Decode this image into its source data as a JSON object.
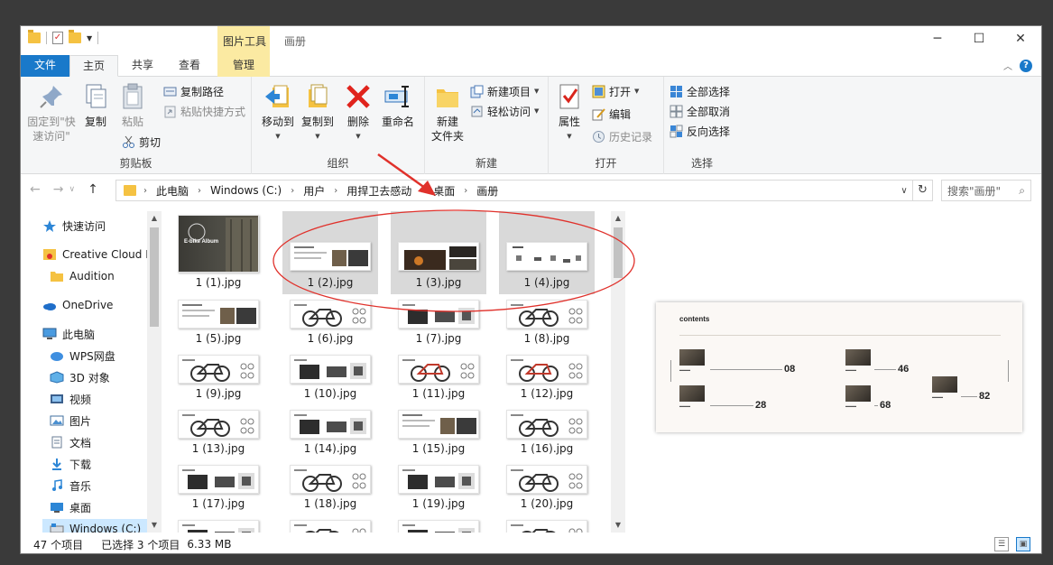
{
  "window": {
    "title": "画册",
    "contextual_tab_group": "图片工具",
    "controls": [
      "─",
      "☐",
      "✕"
    ]
  },
  "ribbon_tabs": [
    "文件",
    "主页",
    "共享",
    "查看",
    "管理"
  ],
  "ribbon": {
    "clipboard": {
      "label": "剪贴板",
      "pin": "固定到\"快\n速访问\"",
      "copy": "复制",
      "paste": "粘贴",
      "copy_path": "复制路径",
      "paste_shortcut": "粘贴快捷方式",
      "cut": "剪切"
    },
    "organize": {
      "label": "组织",
      "move_to": "移动到",
      "copy_to": "复制到",
      "delete": "删除",
      "rename": "重命名"
    },
    "new": {
      "label": "新建",
      "new_folder": "新建\n文件夹",
      "new_item": "新建项目",
      "easy_access": "轻松访问"
    },
    "open": {
      "label": "打开",
      "properties": "属性",
      "open": "打开",
      "edit": "编辑",
      "history": "历史记录"
    },
    "select": {
      "label": "选择",
      "select_all": "全部选择",
      "select_none": "全部取消",
      "invert": "反向选择"
    }
  },
  "address": {
    "crumbs": [
      "此电脑",
      "Windows (C:)",
      "用户",
      "用捍卫去感动",
      "桌面",
      "画册"
    ],
    "search_placeholder": "搜索\"画册\""
  },
  "nav_pane": [
    {
      "label": "快速访问",
      "icon": "star-icon",
      "level": 0
    },
    {
      "label": "Creative Cloud F",
      "icon": "creative-cloud-icon",
      "level": 0
    },
    {
      "label": "Audition",
      "icon": "folder-icon",
      "level": 1
    },
    {
      "label": "OneDrive",
      "icon": "cloud-icon",
      "level": 0
    },
    {
      "label": "此电脑",
      "icon": "computer-icon",
      "level": 0
    },
    {
      "label": "WPS网盘",
      "icon": "wps-cloud-icon",
      "level": 1
    },
    {
      "label": "3D 对象",
      "icon": "3d-objects-icon",
      "level": 1
    },
    {
      "label": "视频",
      "icon": "video-icon",
      "level": 1
    },
    {
      "label": "图片",
      "icon": "pictures-icon",
      "level": 1
    },
    {
      "label": "文档",
      "icon": "documents-icon",
      "level": 1
    },
    {
      "label": "下载",
      "icon": "download-icon",
      "level": 1
    },
    {
      "label": "音乐",
      "icon": "music-icon",
      "level": 1
    },
    {
      "label": "桌面",
      "icon": "desktop-icon",
      "level": 1
    },
    {
      "label": "Windows (C:)",
      "icon": "drive-icon",
      "level": 1
    }
  ],
  "files": [
    {
      "name": "1 (1).jpg",
      "selected": false,
      "style": "dark"
    },
    {
      "name": "1 (2).jpg",
      "selected": true,
      "style": "light"
    },
    {
      "name": "1 (3).jpg",
      "selected": true,
      "style": "light-dark"
    },
    {
      "name": "1 (4).jpg",
      "selected": true,
      "style": "sparse"
    },
    {
      "name": "1 (5).jpg",
      "selected": false,
      "style": "light"
    },
    {
      "name": "1 (6).jpg",
      "selected": false,
      "style": "bike"
    },
    {
      "name": "1 (7).jpg",
      "selected": false,
      "style": "parts"
    },
    {
      "name": "1 (8).jpg",
      "selected": false,
      "style": "bike"
    },
    {
      "name": "1 (9).jpg",
      "selected": false,
      "style": "bike"
    },
    {
      "name": "1 (10).jpg",
      "selected": false,
      "style": "parts"
    },
    {
      "name": "1 (11).jpg",
      "selected": false,
      "style": "bike-red"
    },
    {
      "name": "1 (12).jpg",
      "selected": false,
      "style": "bike-red"
    },
    {
      "name": "1 (13).jpg",
      "selected": false,
      "style": "bike"
    },
    {
      "name": "1 (14).jpg",
      "selected": false,
      "style": "parts"
    },
    {
      "name": "1 (15).jpg",
      "selected": false,
      "style": "light"
    },
    {
      "name": "1 (16).jpg",
      "selected": false,
      "style": "bike"
    },
    {
      "name": "1 (17).jpg",
      "selected": false,
      "style": "parts"
    },
    {
      "name": "1 (18).jpg",
      "selected": false,
      "style": "bike"
    },
    {
      "name": "1 (19).jpg",
      "selected": false,
      "style": "parts"
    },
    {
      "name": "1 (20).jpg",
      "selected": false,
      "style": "bike"
    },
    {
      "name": "",
      "selected": false,
      "style": "parts"
    },
    {
      "name": "",
      "selected": false,
      "style": "bike"
    },
    {
      "name": "",
      "selected": false,
      "style": "parts"
    },
    {
      "name": "",
      "selected": false,
      "style": "bike"
    }
  ],
  "first_thumb_text": "E-bike Album",
  "preview": {
    "title": "contents",
    "entries": [
      "08",
      "46",
      "28",
      "68",
      "82"
    ]
  },
  "status": {
    "count": "47 个项目",
    "selected": "已选择 3 个项目",
    "size": "6.33 MB"
  },
  "colors": {
    "accent": "#1979ca",
    "selection": "#cce8ff",
    "context_tab": "#fbeaa2",
    "annotation": "#e0312b"
  }
}
